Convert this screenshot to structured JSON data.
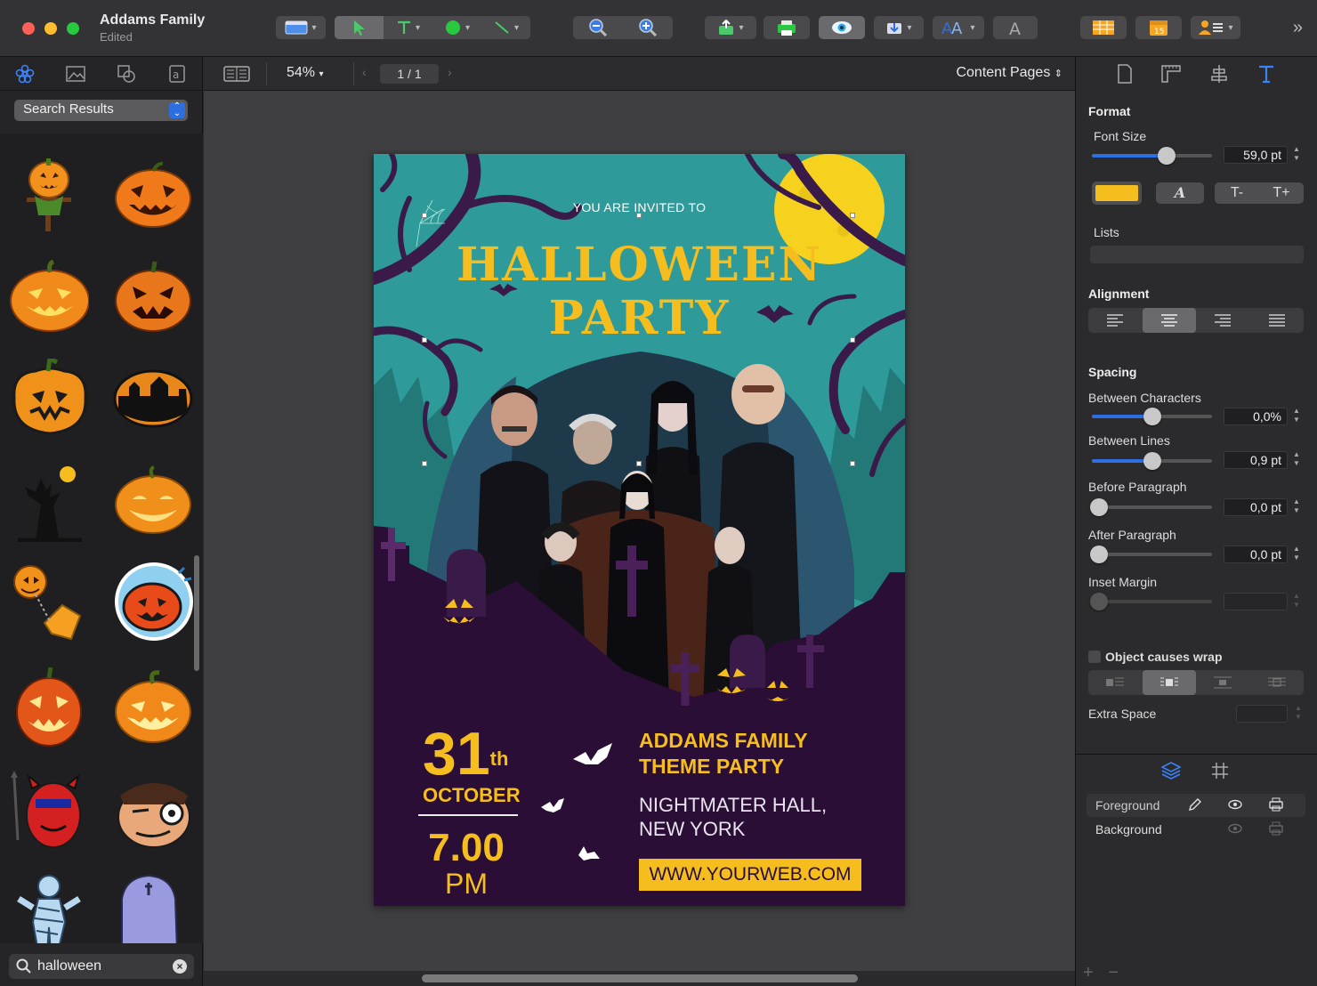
{
  "window": {
    "title": "Addams Family",
    "subtitle": "Edited"
  },
  "library": {
    "source_select": "Search Results",
    "search_value": "halloween"
  },
  "canvas": {
    "zoom": "54%",
    "page_indicator": "1 / 1",
    "view_mode": "Content Pages"
  },
  "poster": {
    "invited": "YOU ARE INVITED TO",
    "title_line1": "HALLOWEEN",
    "title_line2": "PARTY",
    "date_day": "31",
    "date_suffix": "th",
    "date_month": "OCTOBER",
    "time_num": "7.00",
    "time_ampm": "PM",
    "party_line1": "ADDAMS FAMILY",
    "party_line2": "THEME PARTY",
    "venue_line1": "NIGHTMATER HALL,",
    "venue_line2": "NEW YORK",
    "website": "WWW.YOURWEB.COM"
  },
  "inspector": {
    "format_title": "Format",
    "font_size_label": "Font Size",
    "font_size_value": "59,0 pt",
    "font_size_level": 0.62,
    "lists_label": "Lists",
    "alignment_title": "Alignment",
    "spacing_title": "Spacing",
    "between_chars_label": "Between Characters",
    "between_chars_value": "0,0%",
    "between_chars_level": 0.5,
    "between_lines_label": "Between Lines",
    "between_lines_value": "0,9 pt",
    "between_lines_level": 0.5,
    "before_para_label": "Before Paragraph",
    "before_para_value": "0,0 pt",
    "after_para_label": "After Paragraph",
    "after_para_value": "0,0 pt",
    "inset_margin_label": "Inset Margin",
    "wrap_label": "Object causes wrap",
    "extra_space_label": "Extra Space",
    "italic_glyph": "A",
    "shrink_glyph": "T-",
    "grow_glyph": "T+"
  },
  "layers": [
    {
      "name": "Foreground"
    },
    {
      "name": "Background"
    }
  ],
  "colors": {
    "accent": "#2d6fe0",
    "poster_yellow": "#f5be1e",
    "poster_purple": "#2a0e36",
    "poster_teal": "#2f9a9a"
  }
}
